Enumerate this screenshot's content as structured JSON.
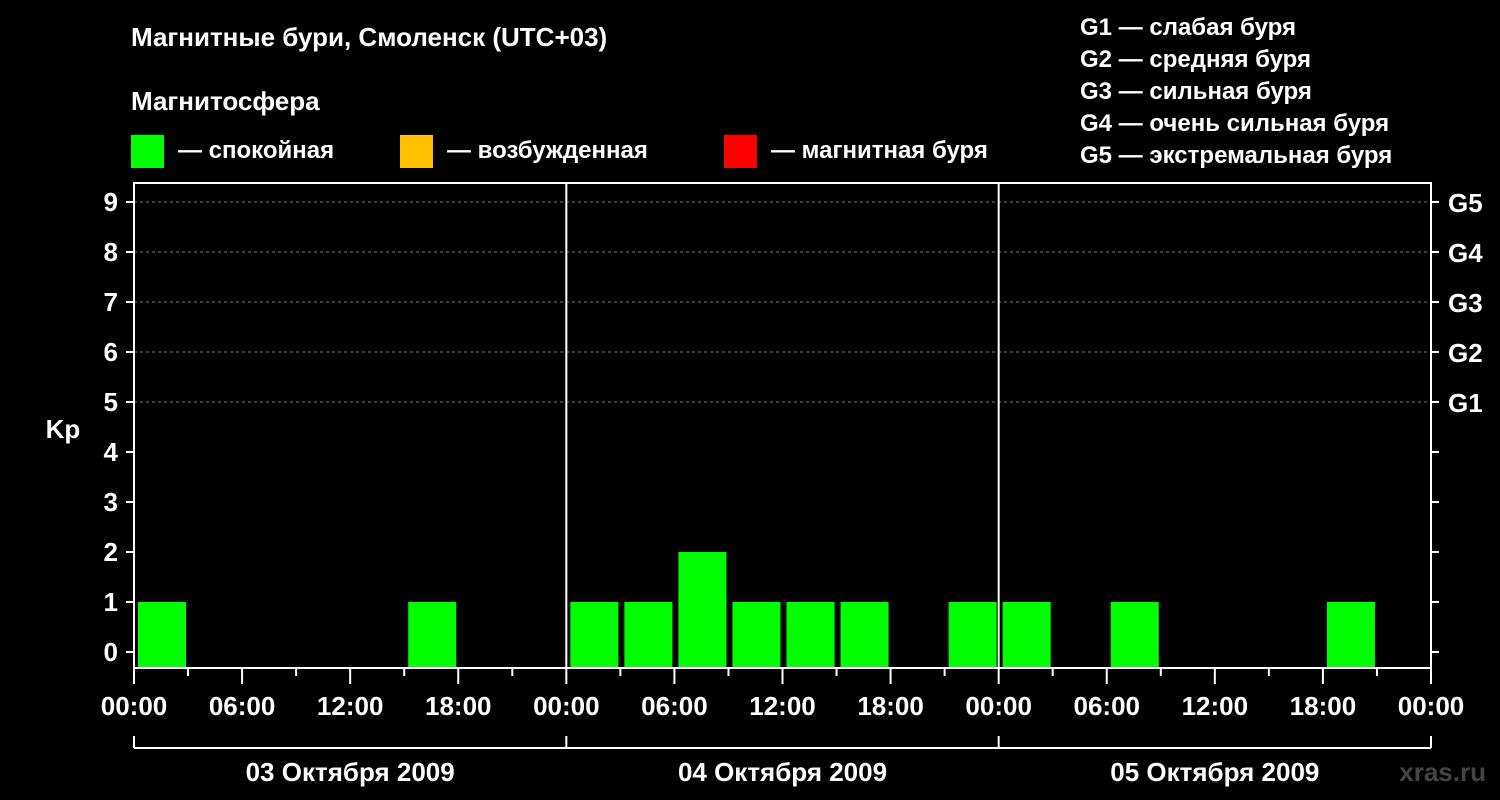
{
  "title": "Магнитные бури, Смоленск (UTC+03)",
  "subtitle": "Магнитосфера",
  "legend": [
    {
      "label": "— спокойная",
      "color": "#00ff00"
    },
    {
      "label": "— возбужденная",
      "color": "#ffc000"
    },
    {
      "label": "— магнитная буря",
      "color": "#ff0000"
    }
  ],
  "g_legend": [
    "G1 — слабая буря",
    "G2 — средняя буря",
    "G3 — сильная буря",
    "G4 — очень сильная буря",
    "G5 — экстремальная буря"
  ],
  "watermark": "xras.ru",
  "chart_data": {
    "type": "bar",
    "ylabel": "Kp",
    "ylim": [
      0,
      9
    ],
    "y_ticks": [
      "0",
      "1",
      "2",
      "3",
      "4",
      "5",
      "6",
      "7",
      "8",
      "9"
    ],
    "right_ticks": [
      {
        "value": 5,
        "label": "G1"
      },
      {
        "value": 6,
        "label": "G2"
      },
      {
        "value": 7,
        "label": "G3"
      },
      {
        "value": 8,
        "label": "G4"
      },
      {
        "value": 9,
        "label": "G5"
      }
    ],
    "x_tick_labels": [
      "00:00",
      "06:00",
      "12:00",
      "18:00",
      "00:00",
      "06:00",
      "12:00",
      "18:00",
      "00:00",
      "06:00",
      "12:00",
      "18:00",
      "00:00"
    ],
    "days": [
      "03 Октября 2009",
      "04 Октября 2009",
      "05 Октября 2009"
    ],
    "interval_hours": 3,
    "values": [
      [
        1,
        0,
        0,
        0,
        0,
        1,
        0,
        0
      ],
      [
        1,
        1,
        2,
        1,
        1,
        1,
        0,
        1
      ],
      [
        1,
        0,
        1,
        0,
        0,
        0,
        1,
        0
      ]
    ],
    "colors": {
      "quiet": "#00ff00",
      "active": "#ffc000",
      "storm": "#ff0000"
    },
    "grid": "dashed at 5–9"
  }
}
